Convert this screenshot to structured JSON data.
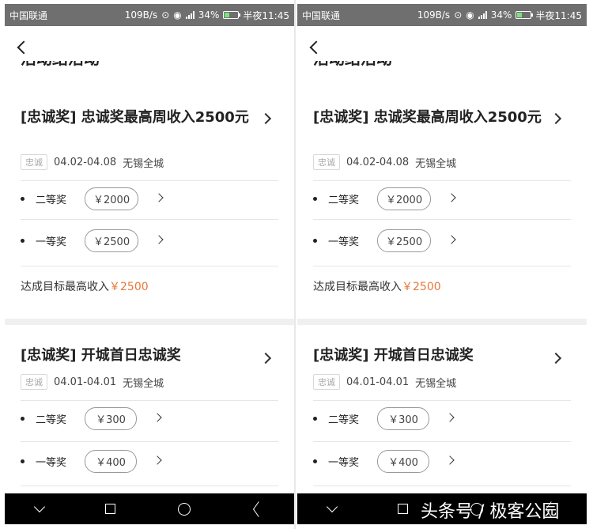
{
  "status_bar": {
    "carrier": "中国联通",
    "speed": "109B/s",
    "network": "4G",
    "battery": "34%",
    "time": "半夜11:45"
  },
  "header": {
    "partial_title": "活动结活动"
  },
  "cards": [
    {
      "title": "[忠诚奖] 忠诚奖最高周收入2500元",
      "tag": "忠诚",
      "date_range": "04.02-04.08",
      "location": "无锡全城",
      "prizes": [
        {
          "label": "二等奖",
          "amount": "￥2000"
        },
        {
          "label": "一等奖",
          "amount": "￥2500"
        }
      ],
      "summary_label": "达成目标最高收入",
      "summary_amount": "￥2500"
    },
    {
      "title": "[忠诚奖] 开城首日忠诚奖",
      "tag": "忠诚",
      "date_range": "04.01-04.01",
      "location": "无锡全城",
      "prizes": [
        {
          "label": "二等奖",
          "amount": "￥300"
        },
        {
          "label": "一等奖",
          "amount": "￥400"
        }
      ]
    }
  ],
  "watermark": "头条号 / 极客公园",
  "colors": {
    "accent": "#e8773a",
    "status_bar": "#6f6f6f",
    "nav_bar": "#000000"
  },
  "icons": [
    "back-arrow-icon",
    "chevron-right-icon",
    "nav-down-icon",
    "nav-recent-icon",
    "nav-home-icon",
    "nav-back-icon",
    "location-icon",
    "eye-icon",
    "signal-icon",
    "battery-icon"
  ]
}
